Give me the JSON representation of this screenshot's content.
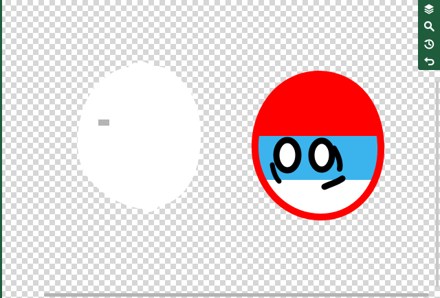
{
  "toolbar": {
    "buttons": [
      {
        "name": "layers",
        "icon": "layers-icon"
      },
      {
        "name": "zoom",
        "icon": "search-icon"
      },
      {
        "name": "history",
        "icon": "history-icon"
      },
      {
        "name": "undo",
        "icon": "undo-icon"
      }
    ],
    "color": "#1e5c3c"
  },
  "canvas": {
    "background": "transparent-checkerboard"
  },
  "drawing": {
    "colors": {
      "outline": "#ff0000",
      "top": "#ff0000",
      "band": "#3bb4ee",
      "bottom": "#ffffff",
      "eyes": "#000000",
      "ghost_shape": "#ffffff",
      "gray_mark": "#b4b4b4"
    }
  }
}
